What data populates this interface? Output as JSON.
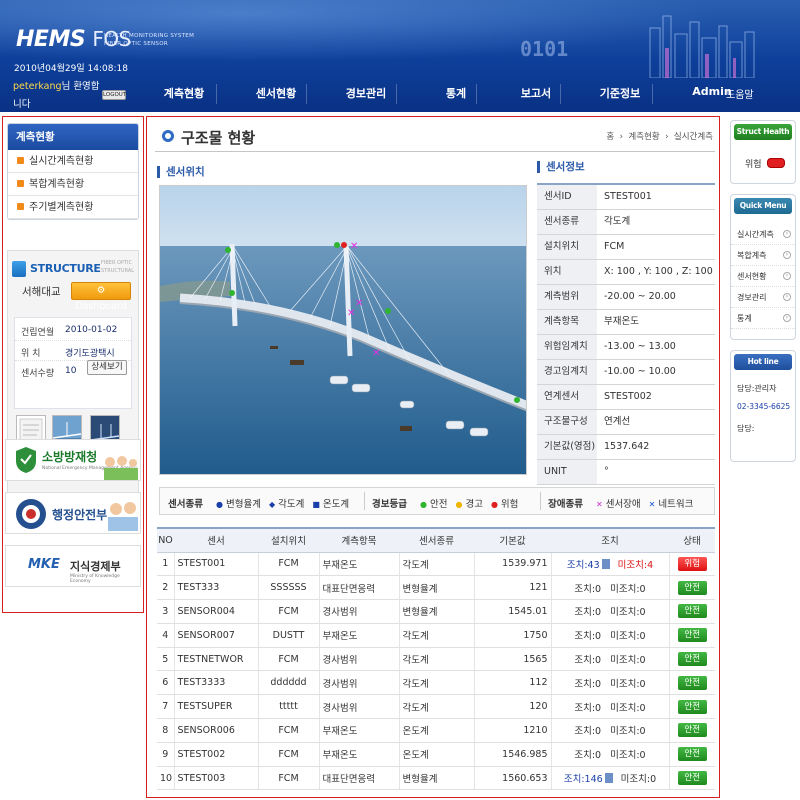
{
  "header": {
    "logo": "HEMS",
    "logo_sub": "FOS",
    "subtitle1": "HEALTH MONITORING SYSTEM",
    "subtitle2": "FIBER OPTIC SENSOR",
    "datetime": "2010년04월29일 14:08:18",
    "user": "peterkang",
    "welcome_suffix": "님 환영합니다",
    "logout": "LOGOUT",
    "help": "도움말",
    "nav": [
      "계측현황",
      "센서현황",
      "경보관리",
      "통계",
      "보고서",
      "기준정보",
      "Admin"
    ]
  },
  "left": {
    "title": "계측현황",
    "items": [
      "실시간계측현황",
      "복합계측현황",
      "주기별계측현황"
    ],
    "structure_logo": "STRUCTURE",
    "structure_logo_sub1": "FIBER OPTIC",
    "structure_logo_sub2": "STRUCTURAL",
    "bridge_name": "서해대교",
    "dashboard": "Dashboard",
    "info": [
      {
        "k": "건립연월",
        "v": "2010-01-02"
      },
      {
        "k": "위    치",
        "v": "경기도광택시"
      },
      {
        "k": "센서수량",
        "v": "10"
      }
    ],
    "detail": "상세보기",
    "banners": [
      {
        "text": "소방방재청",
        "sub": "National Emergency Management Agency"
      },
      {
        "text": "행정안전부",
        "sub": ""
      },
      {
        "text": "지식경제부",
        "sub": "Ministry of Knowledge Economy",
        "mark": "MKE"
      }
    ]
  },
  "main": {
    "title": "구조물 현황",
    "breadcrumb": [
      "홈",
      "계측현황",
      "실시간계측"
    ],
    "section_location": "센서위치",
    "section_info": "센서정보",
    "sensor_info": [
      {
        "k": "센서ID",
        "v": "STEST001"
      },
      {
        "k": "센서종류",
        "v": "각도계"
      },
      {
        "k": "설치위치",
        "v": "FCM"
      },
      {
        "k": "위치",
        "v": "X: 100 , Y: 100 , Z: 100"
      },
      {
        "k": "계측범위",
        "v": "-20.00  ~  20.00"
      },
      {
        "k": "계측항목",
        "v": "부재온도"
      },
      {
        "k": "위험임계치",
        "v": "-13.00  ~  13.00"
      },
      {
        "k": "경고임계치",
        "v": "-10.00  ~  10.00"
      },
      {
        "k": "연계센서",
        "v": "STEST002"
      },
      {
        "k": "구조물구성",
        "v": "연계선"
      },
      {
        "k": "기본값(영점)",
        "v": "1537.642"
      },
      {
        "k": "UNIT",
        "v": "°"
      }
    ],
    "legend": {
      "sensor_type_label": "센서종류",
      "sensor_types": [
        {
          "sym": "●",
          "label": "변형율계",
          "color": "#1a3fa8"
        },
        {
          "sym": "◆",
          "label": "각도계",
          "color": "#1a3fa8"
        },
        {
          "sym": "■",
          "label": "온도계",
          "color": "#1a3fa8"
        }
      ],
      "alarm_label": "경보등급",
      "alarms": [
        {
          "sym": "●",
          "label": "안전",
          "color": "#2fb52f"
        },
        {
          "sym": "●",
          "label": "경고",
          "color": "#f0b400"
        },
        {
          "sym": "●",
          "label": "위험",
          "color": "#e02020"
        }
      ],
      "fault_label": "장애종류",
      "faults": [
        {
          "sym": "✕",
          "label": "센서장애",
          "color": "#d12fd1"
        },
        {
          "sym": "✕",
          "label": "네트워크",
          "color": "#1a4fd1"
        }
      ]
    },
    "table": {
      "headers": [
        "NO",
        "센서",
        "설치위치",
        "계측항목",
        "센서종류",
        "기본값",
        "조치",
        "상태"
      ],
      "rows": [
        {
          "no": "1",
          "sensor": "STEST001",
          "loc": "FCM",
          "item": "부재온도",
          "type": "각도계",
          "base": "1539.971",
          "jo": "조치:43",
          "mi": "미조치:4",
          "status": "위험",
          "flag": "alert"
        },
        {
          "no": "2",
          "sensor": "TEST333",
          "loc": "SSSSSS",
          "item": "대표단면응력",
          "type": "변형율계",
          "base": "121",
          "jo": "조치:0",
          "mi": "미조치:0",
          "status": "안전",
          "flag": "safe"
        },
        {
          "no": "3",
          "sensor": "SENSOR004",
          "loc": "FCM",
          "item": "경사범위",
          "type": "변형율계",
          "base": "1545.01",
          "jo": "조치:0",
          "mi": "미조치:0",
          "status": "안전",
          "flag": "safe"
        },
        {
          "no": "4",
          "sensor": "SENSOR007",
          "loc": "DUSTT",
          "item": "부재온도",
          "type": "각도계",
          "base": "1750",
          "jo": "조치:0",
          "mi": "미조치:0",
          "status": "안전",
          "flag": "safe"
        },
        {
          "no": "5",
          "sensor": "TESTNETWOR",
          "loc": "FCM",
          "item": "경사범위",
          "type": "각도계",
          "base": "1565",
          "jo": "조치:0",
          "mi": "미조치:0",
          "status": "안전",
          "flag": "safe"
        },
        {
          "no": "6",
          "sensor": "TEST3333",
          "loc": "dddddd",
          "item": "경사범위",
          "type": "각도계",
          "base": "112",
          "jo": "조치:0",
          "mi": "미조치:0",
          "status": "안전",
          "flag": "safe"
        },
        {
          "no": "7",
          "sensor": "TESTSUPER",
          "loc": "ttttt",
          "item": "경사범위",
          "type": "각도계",
          "base": "120",
          "jo": "조치:0",
          "mi": "미조치:0",
          "status": "안전",
          "flag": "safe"
        },
        {
          "no": "8",
          "sensor": "SENSOR006",
          "loc": "FCM",
          "item": "부재온도",
          "type": "온도계",
          "base": "1210",
          "jo": "조치:0",
          "mi": "미조치:0",
          "status": "안전",
          "flag": "safe"
        },
        {
          "no": "9",
          "sensor": "STEST002",
          "loc": "FCM",
          "item": "부재온도",
          "type": "온도계",
          "base": "1546.985",
          "jo": "조치:0",
          "mi": "미조치:0",
          "status": "안전",
          "flag": "safe"
        },
        {
          "no": "10",
          "sensor": "STEST003",
          "loc": "FCM",
          "item": "대표단면응력",
          "type": "변형율계",
          "base": "1560.653",
          "jo": "조치:146",
          "mi": "미조치:0",
          "status": "안전",
          "flag": "safe2"
        }
      ]
    }
  },
  "right": {
    "health_title": "Struct Health Check",
    "health_state": "위험",
    "quick_title": "Quick Menu",
    "quick_items": [
      "실시간계측",
      "복합계측",
      "센서현황",
      "경보관리",
      "통계"
    ],
    "hotline_title": "Hot line",
    "hotline_manager": "담당:관리자",
    "hotline_phone": "02-3345-6625",
    "hotline_other": "담당:"
  },
  "colors": {
    "accent": "#1b4aa0",
    "alert": "#e02020",
    "safe": "#2e9e2e",
    "frame": "#d62020"
  }
}
